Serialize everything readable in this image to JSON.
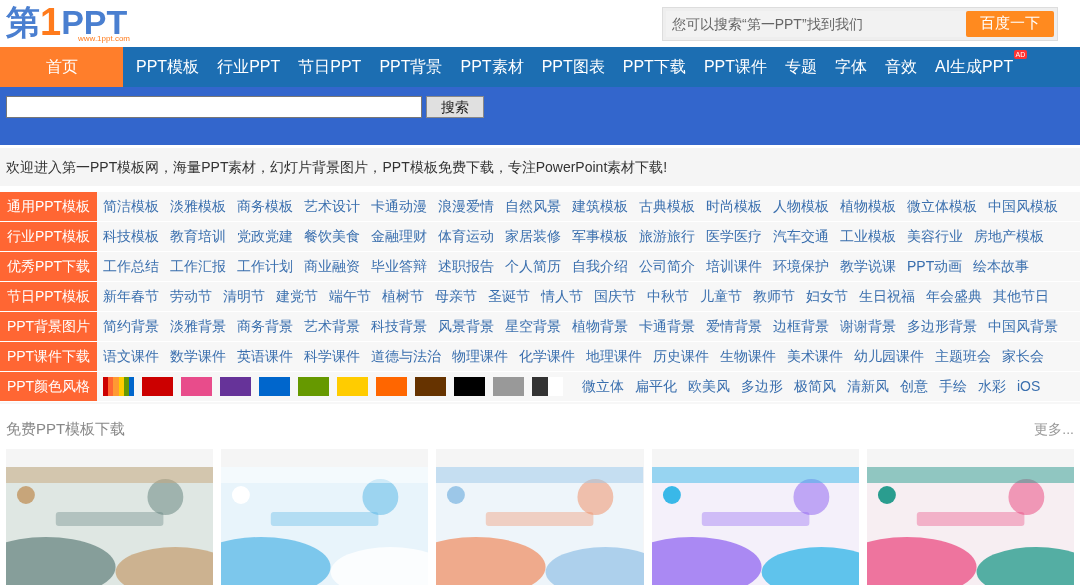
{
  "logo": {
    "part_1": "第",
    "part_2": "1",
    "part_3": "PPT",
    "url": "www.1ppt.com"
  },
  "top_search": {
    "placeholder": "您可以搜索“第一PPT”找到我们",
    "button": "百度一下"
  },
  "nav": [
    {
      "label": "首页",
      "selected": true
    },
    {
      "label": "PPT模板",
      "selected": false
    },
    {
      "label": "行业PPT",
      "selected": false
    },
    {
      "label": "节日PPT",
      "selected": false
    },
    {
      "label": "PPT背景",
      "selected": false
    },
    {
      "label": "PPT素材",
      "selected": false
    },
    {
      "label": "PPT图表",
      "selected": false
    },
    {
      "label": "PPT下载",
      "selected": false
    },
    {
      "label": "PPT课件",
      "selected": false
    },
    {
      "label": "专题",
      "selected": false
    },
    {
      "label": "字体",
      "selected": false
    },
    {
      "label": "音效",
      "selected": false
    },
    {
      "label": "AI生成PPT",
      "selected": false,
      "badge": "AD"
    }
  ],
  "site_search": {
    "button": "搜索"
  },
  "welcome": "欢迎进入第一PPT模板网，海量PPT素材，幻灯片背景图片，PPT模板免费下载，专注PowerPoint素材下载!",
  "categories": [
    {
      "label": "通用PPT模板",
      "links": [
        "简洁模板",
        "淡雅模板",
        "商务模板",
        "艺术设计",
        "卡通动漫",
        "浪漫爱情",
        "自然风景",
        "建筑模板",
        "古典模板",
        "时尚模板",
        "人物模板",
        "植物模板",
        "微立体模板",
        "中国风模板"
      ]
    },
    {
      "label": "行业PPT模板",
      "links": [
        "科技模板",
        "教育培训",
        "党政党建",
        "餐饮美食",
        "金融理财",
        "体育运动",
        "家居装修",
        "军事模板",
        "旅游旅行",
        "医学医疗",
        "汽车交通",
        "工业模板",
        "美容行业",
        "房地产模板"
      ]
    },
    {
      "label": "优秀PPT下载",
      "links": [
        "工作总结",
        "工作汇报",
        "工作计划",
        "商业融资",
        "毕业答辩",
        "述职报告",
        "个人简历",
        "自我介绍",
        "公司简介",
        "培训课件",
        "环境保护",
        "教学说课",
        "PPT动画",
        "绘本故事"
      ]
    },
    {
      "label": "节日PPT模板",
      "links": [
        "新年春节",
        "劳动节",
        "清明节",
        "建党节",
        "端午节",
        "植树节",
        "母亲节",
        "圣诞节",
        "情人节",
        "国庆节",
        "中秋节",
        "儿童节",
        "教师节",
        "妇女节",
        "生日祝福",
        "年会盛典",
        "其他节日"
      ]
    },
    {
      "label": "PPT背景图片",
      "links": [
        "简约背景",
        "淡雅背景",
        "商务背景",
        "艺术背景",
        "科技背景",
        "风景背景",
        "星空背景",
        "植物背景",
        "卡通背景",
        "爱情背景",
        "边框背景",
        "谢谢背景",
        "多边形背景",
        "中国风背景"
      ]
    },
    {
      "label": "PPT课件下载",
      "links": [
        "语文课件",
        "数学课件",
        "英语课件",
        "科学课件",
        "道德与法治",
        "物理课件",
        "化学课件",
        "地理课件",
        "历史课件",
        "生物课件",
        "美术课件",
        "幼儿园课件",
        "主题班会",
        "家长会"
      ]
    },
    {
      "label": "PPT颜色风格",
      "swatches": [
        {
          "kind": "rainbow"
        },
        {
          "kind": "solid",
          "color": "#cc0000"
        },
        {
          "kind": "solid",
          "color": "#e84c8b"
        },
        {
          "kind": "solid",
          "color": "#663399"
        },
        {
          "kind": "solid",
          "color": "#0066cc"
        },
        {
          "kind": "solid",
          "color": "#669900"
        },
        {
          "kind": "solid",
          "color": "#ffcc00"
        },
        {
          "kind": "solid",
          "color": "#ff6600"
        },
        {
          "kind": "solid",
          "color": "#663300"
        },
        {
          "kind": "solid",
          "color": "#000000"
        },
        {
          "kind": "solid",
          "color": "#999999"
        },
        {
          "kind": "split"
        }
      ],
      "links": [
        "微立体",
        "扁平化",
        "欧美风",
        "多边形",
        "极简风",
        "清新风",
        "创意",
        "手绘",
        "水彩",
        "iOS"
      ]
    }
  ],
  "section": {
    "title": "免费PPT模板下载",
    "more": "更多..."
  }
}
